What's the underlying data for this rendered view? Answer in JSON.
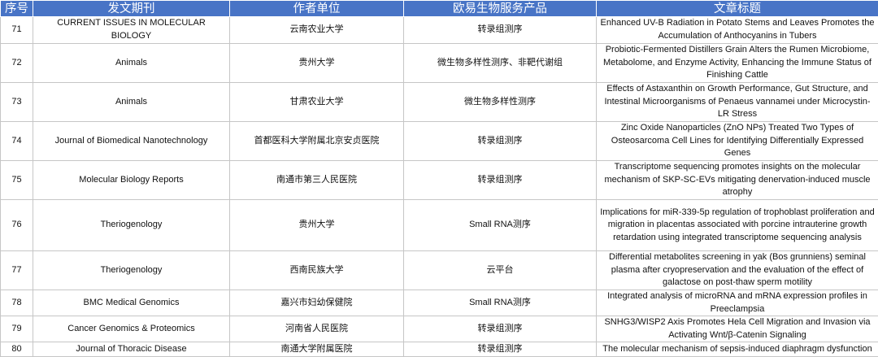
{
  "table": {
    "headers": [
      "序号",
      "发文期刊",
      "作者单位",
      "欧易生物服务产品",
      "文章标题"
    ],
    "rows": [
      {
        "no": "71",
        "journal": "CURRENT ISSUES IN MOLECULAR BIOLOGY",
        "affiliation": "云南农业大学",
        "service": "转录组测序",
        "title": "Enhanced UV-B Radiation in Potato Stems and Leaves Promotes the Accumulation of Anthocyanins in Tubers"
      },
      {
        "no": "72",
        "journal": "Animals",
        "affiliation": "贵州大学",
        "service": "微生物多样性测序、非靶代谢组",
        "title": "Probiotic-Fermented Distillers Grain Alters the Rumen Microbiome, Metabolome, and Enzyme Activity, Enhancing the Immune Status of Finishing Cattle"
      },
      {
        "no": "73",
        "journal": "Animals",
        "affiliation": "甘肃农业大学",
        "service": "微生物多样性测序",
        "title": "Effects of Astaxanthin on Growth Performance, Gut Structure, and Intestinal Microorganisms of Penaeus vannamei under Microcystin-LR Stress"
      },
      {
        "no": "74",
        "journal": "Journal of Biomedical Nanotechnology",
        "affiliation": "首都医科大学附属北京安贞医院",
        "service": "转录组测序",
        "title": "Zinc Oxide Nanoparticles (ZnO NPs) Treated Two Types of Osteosarcoma Cell Lines for Identifying Differentially Expressed Genes"
      },
      {
        "no": "75",
        "journal": "Molecular Biology Reports",
        "affiliation": "南通市第三人民医院",
        "service": "转录组测序",
        "title": "Transcriptome sequencing promotes insights on the molecular mechanism of SKP-SC-EVs mitigating denervation-induced muscle atrophy"
      },
      {
        "no": "76",
        "journal": "Theriogenology",
        "affiliation": "贵州大学",
        "service": "Small RNA测序",
        "title": "Implications for miR-339-5p regulation of trophoblast proliferation and migration in placentas associated with porcine intrauterine growth retardation using integrated transcriptome sequencing analysis"
      },
      {
        "no": "77",
        "journal": "Theriogenology",
        "affiliation": "西南民族大学",
        "service": "云平台",
        "title": "Differential metabolites screening in yak (Bos grunniens) seminal plasma after cryopreservation and the evaluation of the effect of galactose on post-thaw sperm motility"
      },
      {
        "no": "78",
        "journal": "BMC Medical Genomics",
        "affiliation": "嘉兴市妇幼保健院",
        "service": "Small RNA测序",
        "title": "Integrated analysis of microRNA and mRNA expression profiles in Preeclampsia"
      },
      {
        "no": "79",
        "journal": "Cancer Genomics & Proteomics",
        "affiliation": "河南省人民医院",
        "service": "转录组测序",
        "title": "SNHG3/WISP2 Axis Promotes Hela Cell Migration and Invasion via Activating Wnt/β-Catenin Signaling"
      },
      {
        "no": "80",
        "journal": "Journal of Thoracic Disease",
        "affiliation": "南通大学附属医院",
        "service": "转录组测序",
        "title": "The molecular mechanism of sepsis-induced diaphragm dysfunction"
      }
    ]
  }
}
